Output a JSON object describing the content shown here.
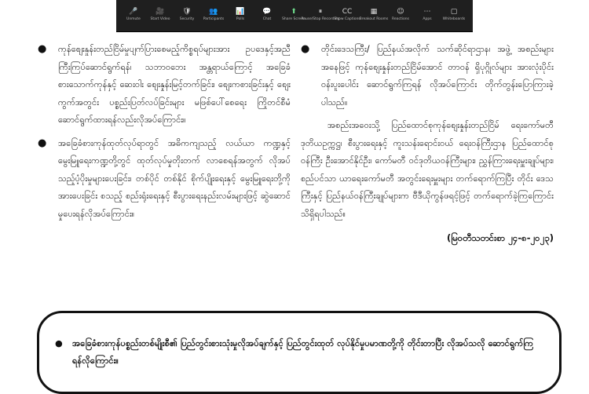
{
  "toolbar": {
    "buttons": [
      {
        "icon": "🎤",
        "label": "Unmute"
      },
      {
        "icon": "🎥",
        "label": "Start Video"
      },
      {
        "icon": "🛡",
        "label": "Security"
      },
      {
        "icon": "👥",
        "label": "Participants"
      },
      {
        "icon": "📊",
        "label": "Polls"
      },
      {
        "icon": "💬",
        "label": "Chat"
      },
      {
        "icon": "⬆",
        "label": "Share Screen"
      },
      {
        "icon": "⏸",
        "label": "Pause/Stop Recording"
      },
      {
        "icon": "CC",
        "label": "Show Captions"
      },
      {
        "icon": "▦",
        "label": "Breakout Rooms"
      },
      {
        "icon": "☺",
        "label": "Reactions"
      },
      {
        "icon": "⋯",
        "label": "Apps"
      },
      {
        "icon": "▢",
        "label": "Whiteboards"
      }
    ]
  },
  "left_column": {
    "bullet1": "ကုန်စျေးနှုန်းတည်ငြိမ်မှုပျက်ပြားစေမည့်ကိစ္စရပ်များအား ဥပဒေနှင့်အညီ ကြီးကြပ်ဆောင်ရွက်ရန်၊ သဘာဝဘေး အန္တရာယ်ကြောင့် အခြေခံစားသောက်ကုန်နှင့် ဆေးဝါး စျေးနှုန်းမြင့်တက်ခြင်း၊ စျေးကစားခြင်းနှင့် စျေးကွက်အတွင်း ပစ္စည်းပြတ်လပ်ခြင်းများ မဖြစ်ပေါ်စေရေး ကြိုတင်စီမံ ဆောင်ရွက်ထားရန်လည်းလိုအပ်ကြောင်း။",
    "bullet2": "အခြေခံစားကုန်ထုတ်လုပ်ရာတွင် အဓိကကျသည့် လယ်ယာ ကဏ္ဍနှင့် မွေးမြူရေးကဏ္ဍတို့တွင် ထုတ်လုပ်မှုတိုးတက် လာစေရန်အတွက် လိုအပ်သည့်ပံ့ပိုးမှုများပေးခြင်း၊ တစ်ပိုင် တစ်နိုင် စိုက်ပျိုးရေးနှင့် မွေးမြူရေးတို့ကိုအားပေးခြင်း စသည့် စည်းရုံးရေးနှင့် စီးပွားရေးနည်းလမ်းများဖြင့် ဆွဲဆောင်မှုပေးရန်လိုအပ်ကြောင်း။"
  },
  "right_column": {
    "bullet1": "တိုင်းဒေသကြီး/ ပြည်နယ်အလိုက် သက်ဆိုင်ရာဌာန၊ အဖွဲ့ အစည်းများအနေဖြင့် ကုန်စျေးနှုန်းတည်ငြိမ်အောင် တာဝန် ရှိပုဂ္ဂိုလ်များ အားလုံးပိုင်းဝန်းပူးပေါင်း ဆောင်ရွက်ကြရန် လိုအပ်ကြောင်း တိုက်တွန်းပြောကြားခဲ့ပါသည်။",
    "paragraph": "အစည်းအဝေးသို့ ပြည်ထောင်စုကုန်စျေးနှုန်းတည်ငြိမ် ရေးကော်မတီ ဒုတိယဥက္ကဋ္ဌ၊ စီးပွားရေးနှင့် ကူးသန်းရောင်းဝယ် ရေးဝန်ကြီးဌာန ပြည်ထောင်စုဝန်ကြီး ဦးအောင်နိုင်ဦး၊ ကော်မတီ ဝင်ဒုတိယဝန်ကြီးများ၊ ညွှန်ကြားရေးမှူးချုပ်များ၊ စည်ပင်သာ ယာရေးကော်မတီ အတွင်းရေးမှူးများ တက်ရောက်ကြပြီး တိုင်း ဒေသကြီးနှင့် ပြည်နယ်ဝန်ကြီးချုပ်များက ဗီဒီယိုကွန်ဖရင့်ဖြင့် တက်ရောက်ခဲ့ကြကြောင်း သိရှိရပါသည်။",
    "source": "(မြဝတီသတင်းစာ ၂၄-၈-၂၀၂၃)"
  },
  "box": {
    "bullet": "အခြေခံစားကုန်ပစ္စည်းတစ်မျိုးစီ၏ ပြည်တွင်းစားသုံးမှုလိုအပ်ချက်နှင့် ပြည်တွင်းထုတ် လုပ်နိုင်မှုပမာဏတို့ကို တိုင်းတာပြီး လိုအပ်သလို ဆောင်ရွက်ကြရန်လိုကြောင်း။"
  }
}
